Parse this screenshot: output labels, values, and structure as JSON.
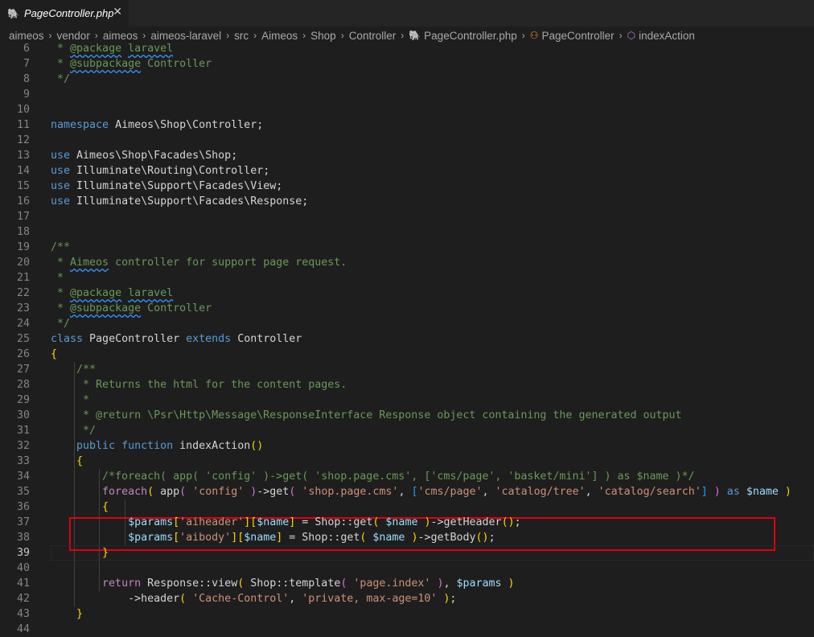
{
  "tab": {
    "filename": "PageController.php",
    "close": "✕",
    "icon": "php-elephant-icon"
  },
  "breadcrumb": {
    "parts": [
      "aimeos",
      "vendor",
      "aimeos",
      "aimeos-laravel",
      "src",
      "Aimeos",
      "Shop",
      "Controller"
    ],
    "file": "PageController.php",
    "class": "PageController",
    "method": "indexAction"
  },
  "editor": {
    "active_line": 39,
    "lines": [
      {
        "n": 6,
        "text": " * @package laravel"
      },
      {
        "n": 7,
        "text": " * @subpackage Controller"
      },
      {
        "n": 8,
        "text": " */"
      },
      {
        "n": 9,
        "text": ""
      },
      {
        "n": 10,
        "text": ""
      },
      {
        "n": 11,
        "text": "namespace Aimeos\\Shop\\Controller;"
      },
      {
        "n": 12,
        "text": ""
      },
      {
        "n": 13,
        "text": "use Aimeos\\Shop\\Facades\\Shop;"
      },
      {
        "n": 14,
        "text": "use Illuminate\\Routing\\Controller;"
      },
      {
        "n": 15,
        "text": "use Illuminate\\Support\\Facades\\View;"
      },
      {
        "n": 16,
        "text": "use Illuminate\\Support\\Facades\\Response;"
      },
      {
        "n": 17,
        "text": ""
      },
      {
        "n": 18,
        "text": ""
      },
      {
        "n": 19,
        "text": "/**"
      },
      {
        "n": 20,
        "text": " * Aimeos controller for support page request."
      },
      {
        "n": 21,
        "text": " *"
      },
      {
        "n": 22,
        "text": " * @package laravel"
      },
      {
        "n": 23,
        "text": " * @subpackage Controller"
      },
      {
        "n": 24,
        "text": " */"
      },
      {
        "n": 25,
        "text": "class PageController extends Controller"
      },
      {
        "n": 26,
        "text": "{"
      },
      {
        "n": 27,
        "text": "    /**"
      },
      {
        "n": 28,
        "text": "     * Returns the html for the content pages."
      },
      {
        "n": 29,
        "text": "     *"
      },
      {
        "n": 30,
        "text": "     * @return \\Psr\\Http\\Message\\ResponseInterface Response object containing the generated output"
      },
      {
        "n": 31,
        "text": "     */"
      },
      {
        "n": 32,
        "text": "    public function indexAction()"
      },
      {
        "n": 33,
        "text": "    {"
      },
      {
        "n": 34,
        "text": "        /*foreach( app( 'config' )->get( 'shop.page.cms', ['cms/page', 'basket/mini'] ) as $name )*/"
      },
      {
        "n": 35,
        "text": "        foreach( app( 'config' )->get( 'shop.page.cms', ['cms/page', 'catalog/tree', 'catalog/search'] ) as $name )"
      },
      {
        "n": 36,
        "text": "        {"
      },
      {
        "n": 37,
        "text": "            $params['aiheader'][$name] = Shop::get( $name )->getHeader();"
      },
      {
        "n": 38,
        "text": "            $params['aibody'][$name] = Shop::get( $name )->getBody();"
      },
      {
        "n": 39,
        "text": "        }"
      },
      {
        "n": 40,
        "text": ""
      },
      {
        "n": 41,
        "text": "        return Response::view( Shop::template( 'page.index' ), $params )"
      },
      {
        "n": 42,
        "text": "            ->header( 'Cache-Control', 'private, max-age=10' );"
      },
      {
        "n": 43,
        "text": "    }"
      },
      {
        "n": 44,
        "text": ""
      }
    ]
  },
  "annotation": {
    "color": "#e3000b"
  }
}
